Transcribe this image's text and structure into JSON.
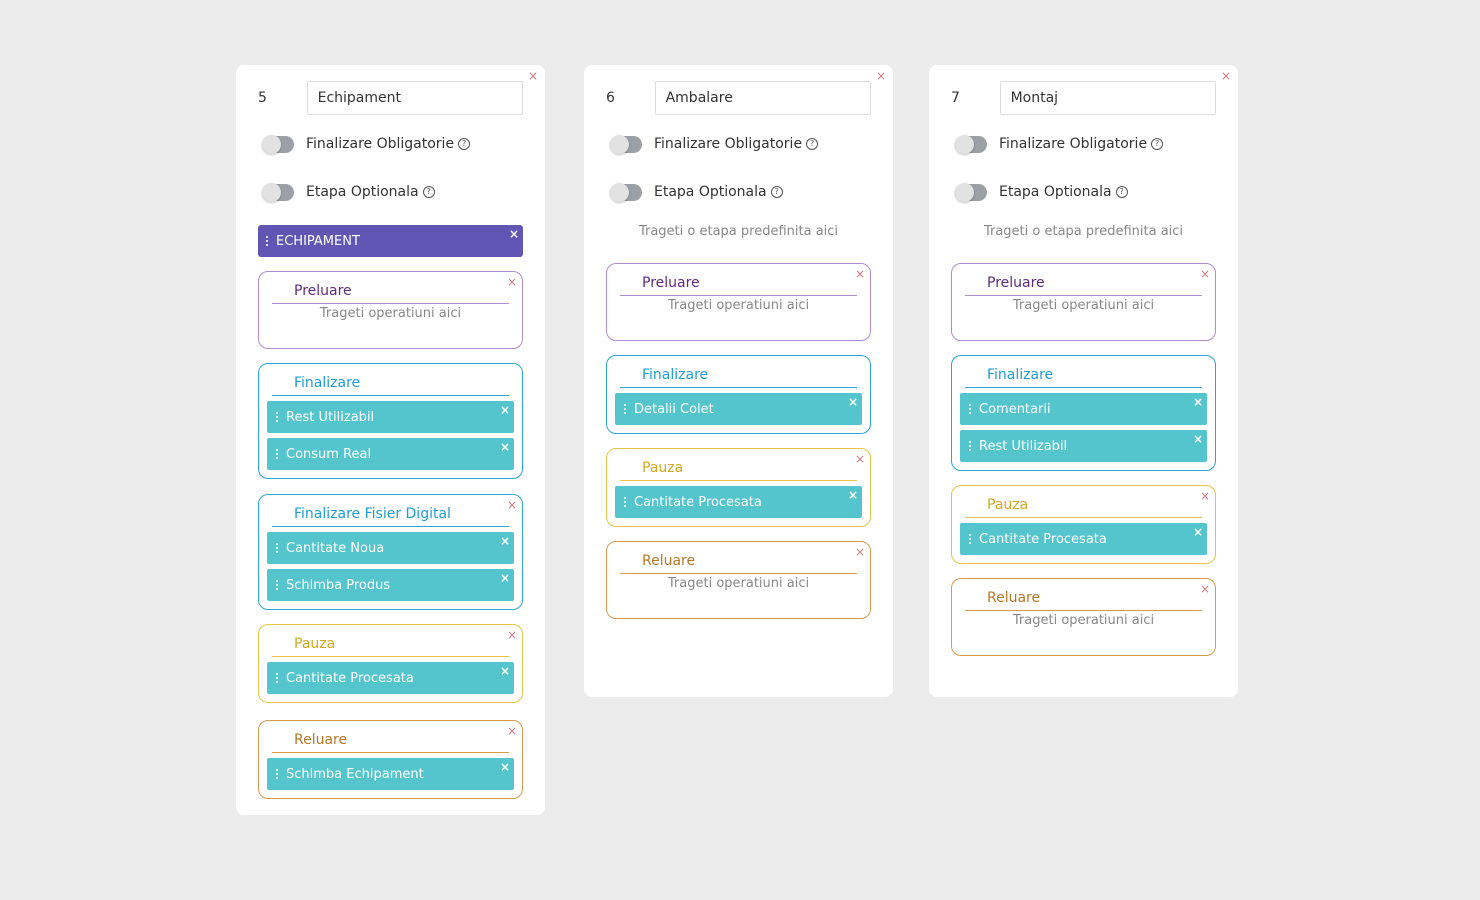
{
  "colors": {
    "background": "#ececec",
    "card": "#ffffff",
    "stage_chip": "#6255b4",
    "operation_chip": "#55c5cd",
    "close_icon": "#d2777d",
    "preluare": "#b08ccd",
    "finalizare": "#2ea5d4",
    "pauza": "#e8c24a",
    "reluare": "#d99a50"
  },
  "common": {
    "close_glyph": "×",
    "help_glyph": "?",
    "toggle_required_label": "Finalizare Obligatorie",
    "toggle_optional_label": "Etapa Optionala",
    "drop_stage_text": "Trageti o etapa predefinita aici",
    "drop_ops_text": "Trageti operatiuni aici"
  },
  "cards": [
    {
      "number": "5",
      "name": "Echipament",
      "stage_chip": "ECHIPAMENT",
      "sections": [
        {
          "title": "Preluare",
          "items": []
        },
        {
          "title": "Finalizare",
          "items": [
            "Rest Utilizabil",
            "Consum Real"
          ]
        },
        {
          "title": "Finalizare Fisier Digital",
          "items": [
            "Cantitate Noua",
            "Schimba Produs"
          ]
        },
        {
          "title": "Pauza",
          "items": [
            "Cantitate Procesata"
          ]
        },
        {
          "title": "Reluare",
          "items": [
            "Schimba Echipament"
          ]
        }
      ]
    },
    {
      "number": "6",
      "name": "Ambalare",
      "stage_chip": "",
      "sections": [
        {
          "title": "Preluare",
          "items": []
        },
        {
          "title": "Finalizare",
          "items": [
            "Detalii Colet"
          ]
        },
        {
          "title": "Pauza",
          "items": [
            "Cantitate Procesata"
          ]
        },
        {
          "title": "Reluare",
          "items": []
        }
      ]
    },
    {
      "number": "7",
      "name": "Montaj",
      "stage_chip": "",
      "sections": [
        {
          "title": "Preluare",
          "items": []
        },
        {
          "title": "Finalizare",
          "items": [
            "Comentarii",
            "Rest Utilizabil"
          ]
        },
        {
          "title": "Pauza",
          "items": [
            "Cantitate Procesata"
          ]
        },
        {
          "title": "Reluare",
          "items": []
        }
      ]
    }
  ]
}
